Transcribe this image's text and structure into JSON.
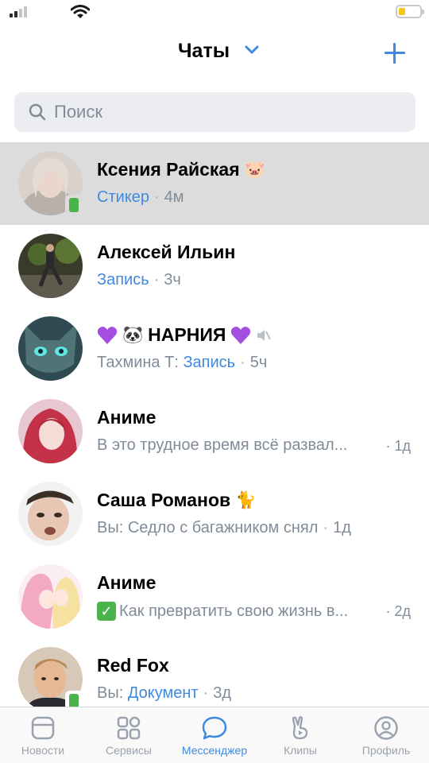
{
  "header": {
    "title": "Чаты"
  },
  "search": {
    "placeholder": "Поиск"
  },
  "chats": [
    {
      "name": "Ксения Райская",
      "name_emoji": "🐷",
      "preview_highlight": "Стикер",
      "time": "4м"
    },
    {
      "name": "Алексей Ильин",
      "preview_highlight": "Запись",
      "time": "3ч"
    },
    {
      "name": "НАРНИЯ",
      "name_emoji": "🐼",
      "preview_author": "Тахмина Т:",
      "preview_highlight": "Запись",
      "time": "5ч"
    },
    {
      "name": "Аниме",
      "preview_text": "В это трудное время всё развал...",
      "time": "1д"
    },
    {
      "name": "Саша Романов",
      "name_emoji": "🐈",
      "preview_text": "Вы: Седло с багажником снял",
      "time": "1д"
    },
    {
      "name": "Аниме",
      "preview_text": "Как превратить свою жизнь в...",
      "time": "2д"
    },
    {
      "name": "Red Fox",
      "preview_author": "Вы:",
      "preview_highlight": "Документ",
      "time": "3д"
    }
  ],
  "tabs": [
    {
      "label": "Новости",
      "icon": "news-icon"
    },
    {
      "label": "Сервисы",
      "icon": "services-icon"
    },
    {
      "label": "Мессенджер",
      "icon": "messenger-icon"
    },
    {
      "label": "Клипы",
      "icon": "clips-icon"
    },
    {
      "label": "Профиль",
      "icon": "profile-icon"
    }
  ],
  "colors": {
    "accent": "#3f8ae0",
    "muted": "#818c99",
    "online": "#4bb34b",
    "selected_row": "#dcdcdc"
  }
}
